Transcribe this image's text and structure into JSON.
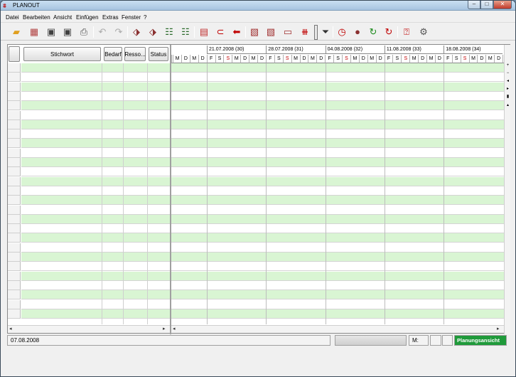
{
  "window": {
    "title": "PLANOUT",
    "min": "–",
    "max": "□",
    "close": "✕"
  },
  "menu": [
    "Datei",
    "Bearbeiten",
    "Ansicht",
    "Einfügen",
    "Extras",
    "Fenster",
    "?"
  ],
  "grid": {
    "columns": [
      "Stichwort",
      "Bedarf",
      "Resso...",
      "Status"
    ]
  },
  "weeks": [
    "21.07.2008 (30)",
    "28.07.2008 (31)",
    "04.08.2008 (32)",
    "11.08.2008 (33)",
    "18.08.2008 (34)"
  ],
  "days": [
    "M",
    "D",
    "M",
    "D",
    "F",
    "S",
    "S"
  ],
  "status": {
    "date": "07.08.2008",
    "m_label": "M:",
    "mode": "Planungsansicht"
  },
  "colors": {
    "row_green": "#d9f5d3",
    "mode_bg": "#1f9a3a",
    "sunday": "#c00000"
  }
}
